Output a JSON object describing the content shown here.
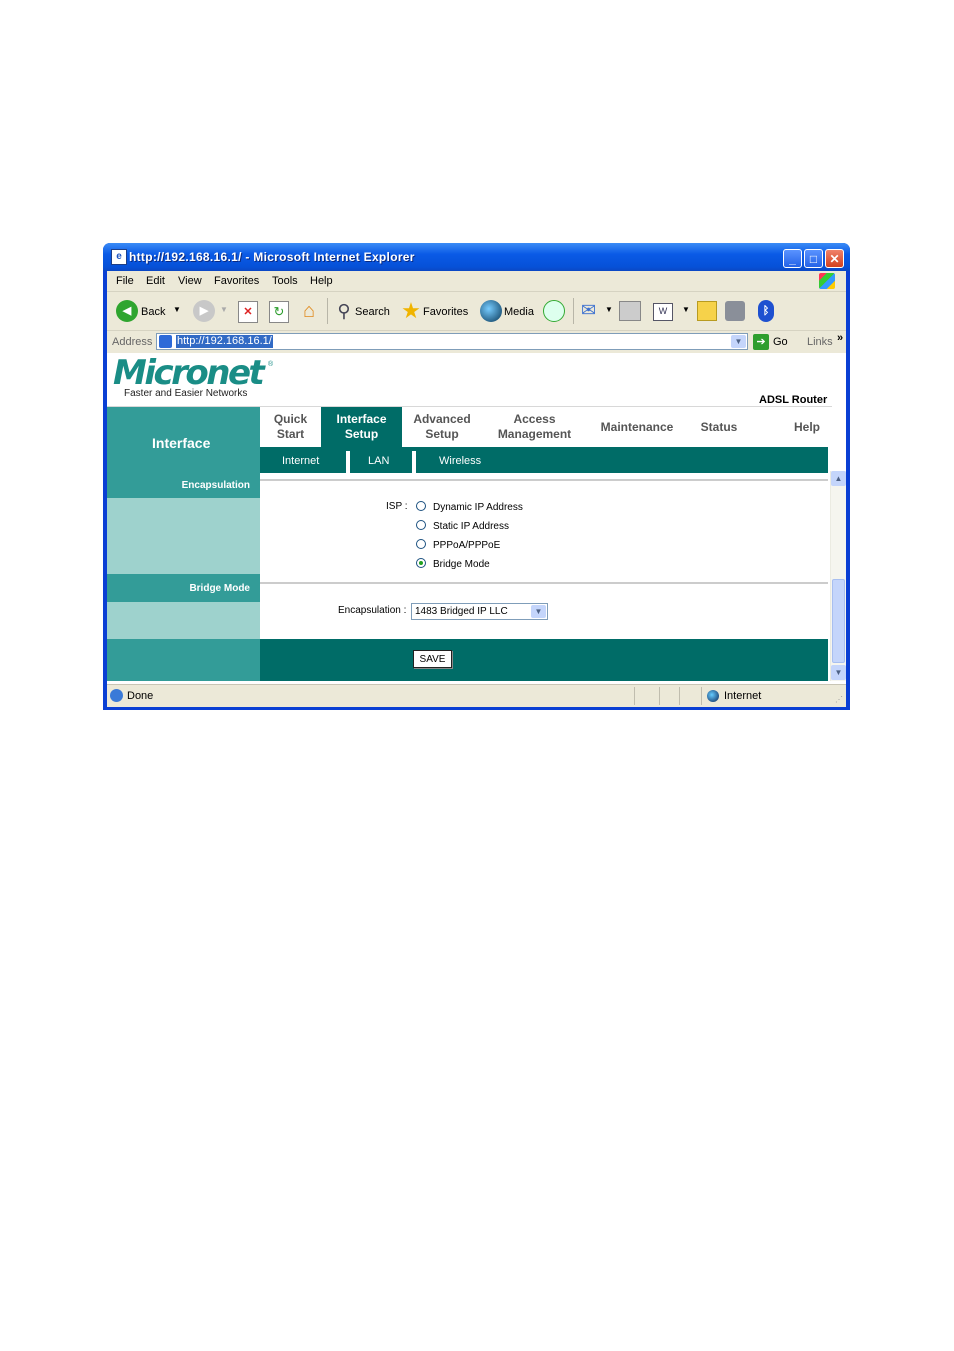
{
  "window": {
    "title": "http://192.168.16.1/ - Microsoft Internet Explorer"
  },
  "menu": [
    "File",
    "Edit",
    "View",
    "Favorites",
    "Tools",
    "Help"
  ],
  "toolbar": {
    "back": "Back",
    "search": "Search",
    "favorites": "Favorites",
    "media": "Media"
  },
  "address": {
    "label": "Address",
    "url": "http://192.168.16.1/",
    "go": "Go",
    "links": "Links",
    "more": "»"
  },
  "page": {
    "brand": "Micronet",
    "reg": "®",
    "tagline": "Faster and Easier Networks",
    "product": "ADSL Router",
    "section": "Interface",
    "nav": [
      {
        "line1": "Quick",
        "line2": "Start"
      },
      {
        "line1": "Interface",
        "line2": "Setup"
      },
      {
        "line1": "Advanced",
        "line2": "Setup"
      },
      {
        "line1": "Access",
        "line2": "Management"
      },
      {
        "line1": "Maintenance",
        "line2": ""
      },
      {
        "line1": "Status",
        "line2": ""
      },
      {
        "line1": "Help",
        "line2": ""
      }
    ],
    "subnav": [
      "Internet",
      "LAN",
      "Wireless"
    ],
    "encapsulation_label": "Encapsulation",
    "isp_label": "ISP :",
    "isp_options": [
      "Dynamic IP Address",
      "Static IP Address",
      "PPPoA/PPPoE",
      "Bridge Mode"
    ],
    "isp_selected": "Bridge Mode",
    "bridge_label": "Bridge Mode",
    "encap_field_label": "Encapsulation :",
    "encap_value": "1483 Bridged IP LLC",
    "save": "SAVE"
  },
  "status": {
    "text": "Done",
    "zone": "Internet"
  },
  "colors": {
    "teal_dark": "#006c67",
    "teal": "#339c98",
    "teal_light": "#9ed2cd",
    "xp_blue": "#0a5ae6"
  }
}
